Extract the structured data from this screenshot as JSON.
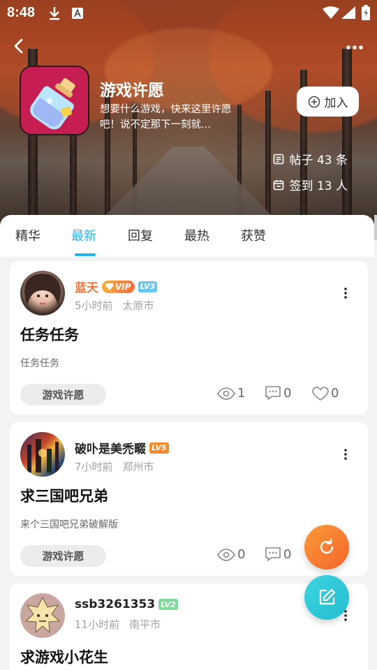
{
  "status_bar": {
    "time": "8:48"
  },
  "group": {
    "title": "游戏许愿",
    "description": "想要什么游戏，快来这里许愿吧！说不定那下一刻就...",
    "join_label": "加入",
    "posts_stat": "帖子 43 条",
    "checkin_stat": "签到 13 人"
  },
  "tabs": [
    {
      "label": "精华"
    },
    {
      "label": "最新",
      "active": true
    },
    {
      "label": "回复"
    },
    {
      "label": "最热"
    },
    {
      "label": "获赞"
    }
  ],
  "posts": [
    {
      "username": "蓝天",
      "username_color": "#f2743a",
      "vip_badge": "VIP",
      "level": "LV3",
      "level_color": "#6cc6f0",
      "time": "5小时前",
      "city": "太原市",
      "title": "任务任务",
      "body": "任务任务",
      "tag": "游戏许愿",
      "views": "1",
      "comments": "0",
      "likes": "0"
    },
    {
      "username": "破卟是美禿畷",
      "username_color": "#222222",
      "level": "LV5",
      "level_color": "#f38a2c",
      "time": "7小时前",
      "city": "郑州市",
      "title": "求三国吧兄弟",
      "body": "来个三国吧兄弟破解版",
      "tag": "游戏许愿",
      "views": "0",
      "comments": "0"
    },
    {
      "username": "ssb3261353",
      "username_color": "#222222",
      "level": "LV2",
      "level_color": "#7fd99a",
      "time": "11小时前",
      "city": "南平市",
      "title": "求游戏小花生"
    }
  ],
  "colors": {
    "accent": "#25b5e8",
    "fab_refresh": "#f97a2d",
    "fab_edit": "#2ec8d6"
  },
  "icons": [
    "download-icon",
    "a-icon",
    "wifi-icon",
    "signal-icon",
    "battery-icon",
    "back-icon",
    "more-icon",
    "plus-circle-icon",
    "post-icon",
    "checkin-icon",
    "eye-icon",
    "comment-icon",
    "heart-icon",
    "refresh-icon",
    "edit-icon"
  ]
}
